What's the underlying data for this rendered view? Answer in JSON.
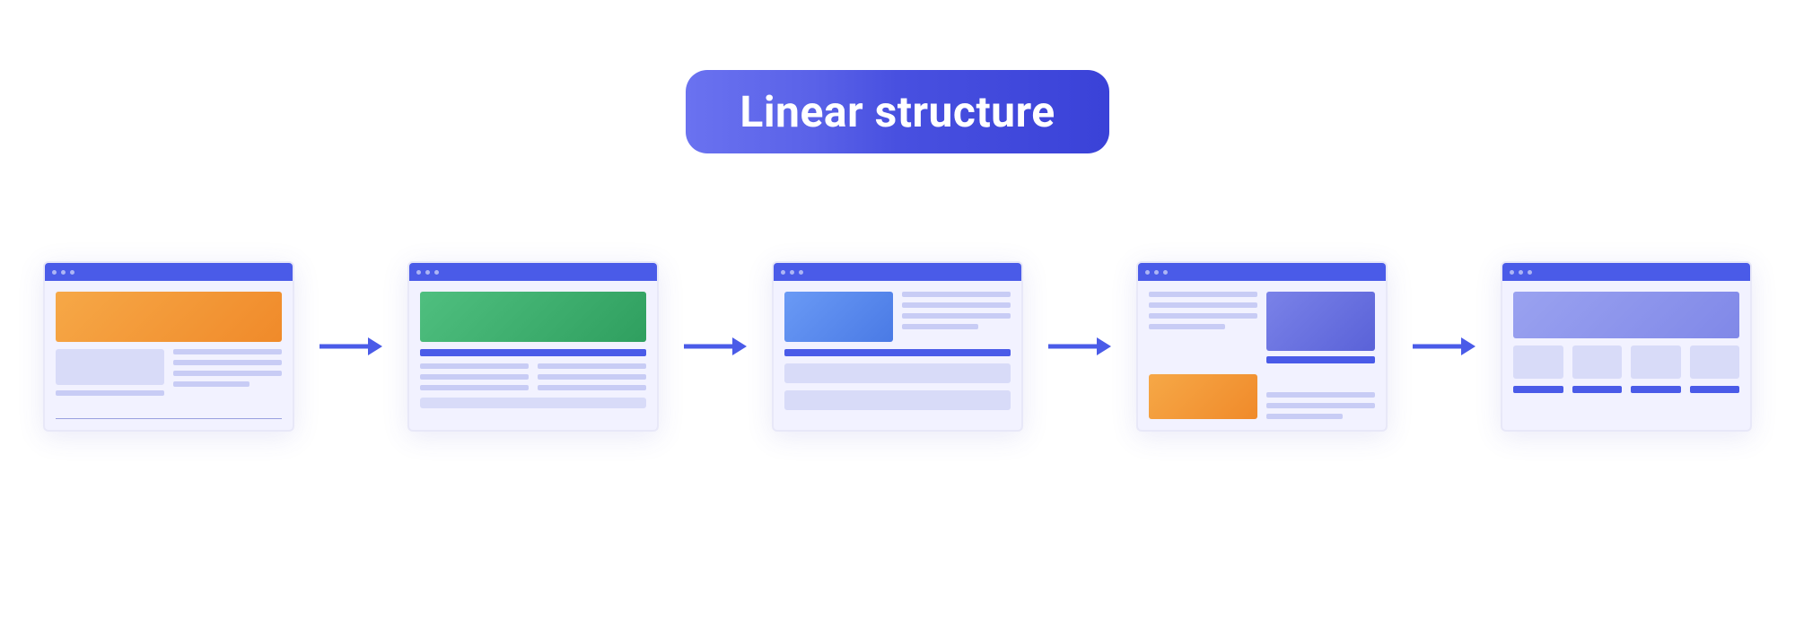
{
  "title": "Linear structure",
  "colors": {
    "primary": "#4a5be8",
    "orange": "#f08a2a",
    "green": "#2f9f5f",
    "blue": "#4a7ae5",
    "indigo": "#5a62d8",
    "violet": "#8088e8"
  },
  "diagram": {
    "type": "linear-flow",
    "nodes": [
      {
        "id": "page-1",
        "hero_color": "orange",
        "layout": "hero-two-col"
      },
      {
        "id": "page-2",
        "hero_color": "green",
        "layout": "hero-lines"
      },
      {
        "id": "page-3",
        "hero_color": "blue",
        "layout": "split-hero-lines"
      },
      {
        "id": "page-4",
        "hero_color": "indigo",
        "layout": "lines-and-blocks-reverse"
      },
      {
        "id": "page-5",
        "hero_color": "violet",
        "layout": "hero-cards"
      }
    ],
    "arrows": 4
  }
}
